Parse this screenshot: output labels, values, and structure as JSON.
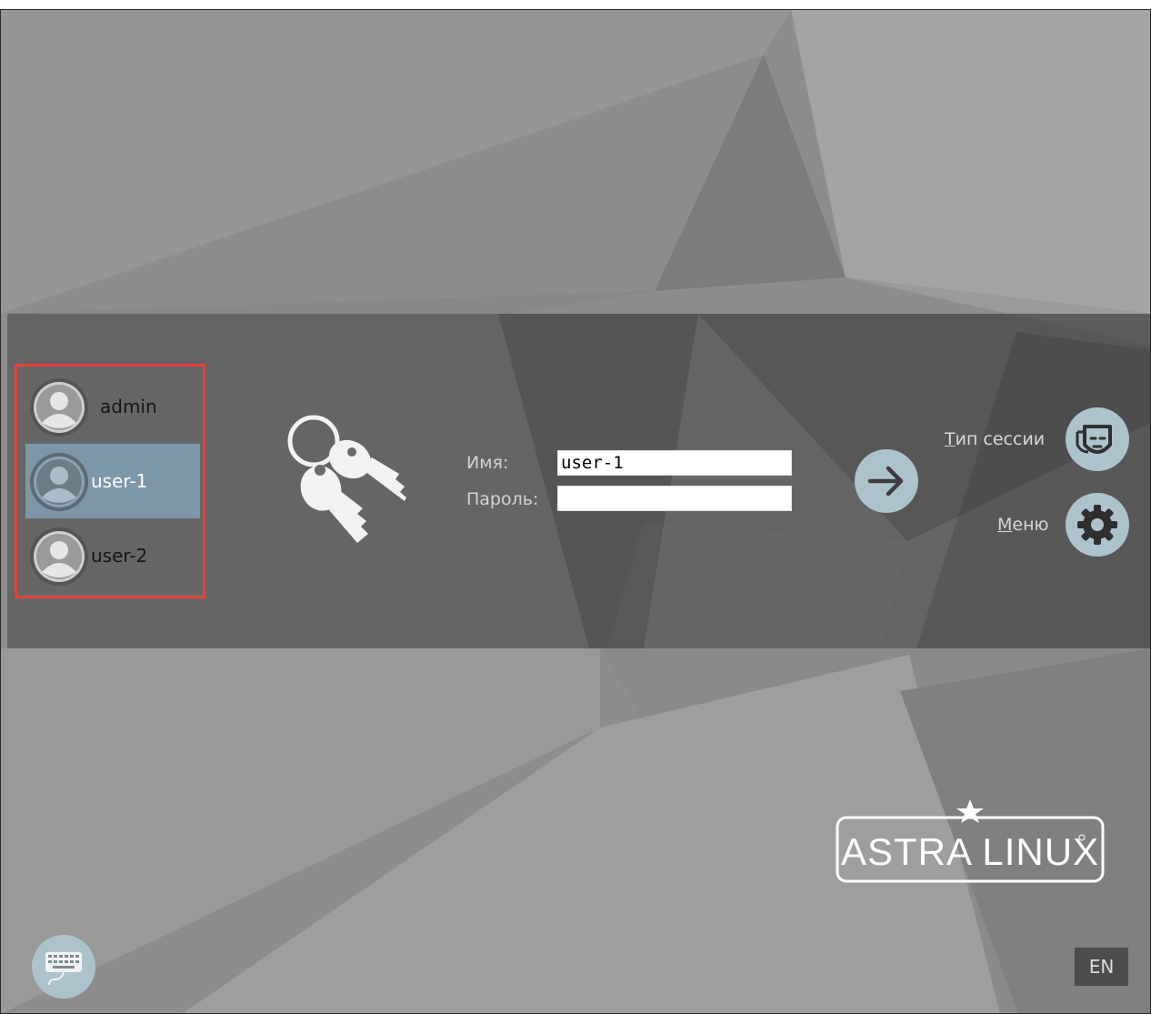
{
  "users": [
    {
      "name": "admin",
      "selected": false
    },
    {
      "name": "user-1",
      "selected": true
    },
    {
      "name": "user-2",
      "selected": false
    }
  ],
  "login": {
    "name_label": "Имя:",
    "password_label": "Пароль:",
    "name_value": "user-1",
    "password_value": ""
  },
  "session": {
    "session_type_underlined": "Т",
    "session_type_rest": "ип сессии",
    "menu_underlined": "М",
    "menu_rest": "еню"
  },
  "logo": {
    "text": "ASTRA LINUX"
  },
  "keyboard": {
    "icon": "keyboard-icon"
  },
  "language": {
    "code": "EN"
  },
  "colors": {
    "selection": "#7e97a8",
    "highlight_border": "#e8403a",
    "button_fill": "#adc3cc",
    "band": "#5a5a5a"
  }
}
